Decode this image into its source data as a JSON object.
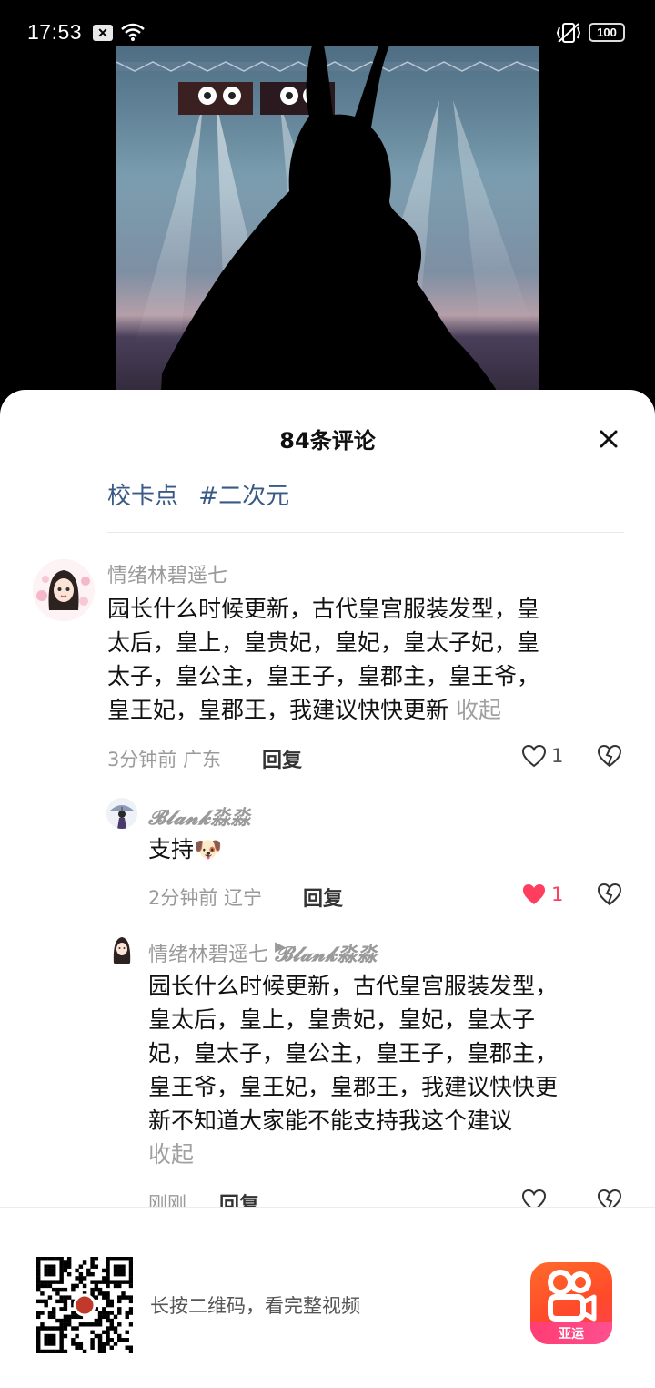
{
  "status_bar": {
    "time": "17:53",
    "battery": "100"
  },
  "sheet": {
    "title": "84条评论",
    "tags": [
      "校卡点",
      "#二次元"
    ]
  },
  "comments": [
    {
      "name": "情绪林碧遥七",
      "text": "园长什么时候更新，古代皇宫服装发型，皇太后，皇上，皇贵妃，皇妃，皇太子妃，皇太子，皇公主，皇王子，皇郡主，皇王爷，皇王妃，皇郡王，我建议快快更新",
      "collapse": "收起",
      "meta": "3分钟前 广东",
      "reply": "回复",
      "likes": "1"
    },
    {
      "name": "𝓑𝓵𝓪𝓷𝓴淼淼",
      "text": "支持",
      "emoji": "🐶",
      "meta": "2分钟前 辽宁",
      "reply": "回复",
      "likes": "1",
      "liked_color": "#ff3d5f"
    },
    {
      "name": "情绪林碧遥七",
      "reply_to": "𝓑𝓵𝓪𝓷𝓴淼淼",
      "text_lines": [
        "园长什么时候更新，古代皇宫服装发型，",
        "皇太后，皇上，皇贵妃，皇妃，皇太子",
        "妃，皇太子，皇公主，皇王子，皇郡主，",
        "皇王爷，皇王妃，皇郡王，我建议快快更",
        "新不知道大家能不能支持我这个建议"
      ],
      "collapse": "收起",
      "meta": "刚刚",
      "reply": "回复"
    }
  ],
  "comment1_lines": [
    "园长什么时候更新，古代皇宫服装发型，皇",
    "太后，皇上，皇贵妃，皇妃，皇太子妃，皇",
    "太子，皇公主，皇王子，皇郡主，皇王爷，",
    "皇王妃，皇郡王，我建议快快更新"
  ],
  "bottom": {
    "qr_hint": "长按二维码，看完整视频",
    "app_logo_text": "亚运"
  },
  "icons": [
    "wifi-icon",
    "vibrate-icon",
    "close-icon",
    "heart-icon",
    "broken-heart-icon",
    "play-triangle-icon",
    "qr-code",
    "kuaishou-logo"
  ]
}
